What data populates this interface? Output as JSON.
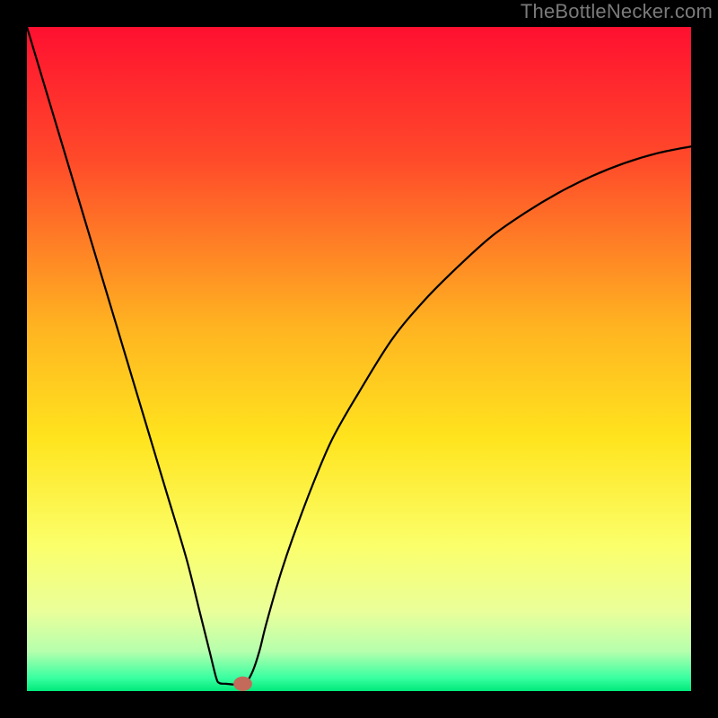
{
  "watermark": "TheBottleNecker.com",
  "chart_data": {
    "type": "line",
    "title": "",
    "xlabel": "",
    "ylabel": "",
    "xlim": [
      0,
      100
    ],
    "ylim": [
      0,
      100
    ],
    "gradient_stops": [
      {
        "offset": 0,
        "color": "#ff1030"
      },
      {
        "offset": 20,
        "color": "#ff4a2a"
      },
      {
        "offset": 45,
        "color": "#ffb321"
      },
      {
        "offset": 62,
        "color": "#ffe41e"
      },
      {
        "offset": 78,
        "color": "#fbff6a"
      },
      {
        "offset": 88,
        "color": "#eaff9a"
      },
      {
        "offset": 94,
        "color": "#b6ffad"
      },
      {
        "offset": 98,
        "color": "#3affa1"
      },
      {
        "offset": 100,
        "color": "#00e97a"
      }
    ],
    "curve_points": [
      {
        "x": 0,
        "y": 100
      },
      {
        "x": 3,
        "y": 90
      },
      {
        "x": 6,
        "y": 80
      },
      {
        "x": 9,
        "y": 70
      },
      {
        "x": 12,
        "y": 60
      },
      {
        "x": 15,
        "y": 50
      },
      {
        "x": 18,
        "y": 40
      },
      {
        "x": 21,
        "y": 30
      },
      {
        "x": 24,
        "y": 20
      },
      {
        "x": 26,
        "y": 12
      },
      {
        "x": 27.5,
        "y": 6
      },
      {
        "x": 28.5,
        "y": 2
      },
      {
        "x": 29,
        "y": 1.2
      },
      {
        "x": 30,
        "y": 1.1
      },
      {
        "x": 31,
        "y": 1
      },
      {
        "x": 32,
        "y": 1
      },
      {
        "x": 33,
        "y": 1.3
      },
      {
        "x": 34,
        "y": 3
      },
      {
        "x": 35,
        "y": 6
      },
      {
        "x": 36,
        "y": 10
      },
      {
        "x": 38,
        "y": 17
      },
      {
        "x": 40,
        "y": 23
      },
      {
        "x": 43,
        "y": 31
      },
      {
        "x": 46,
        "y": 38
      },
      {
        "x": 50,
        "y": 45
      },
      {
        "x": 55,
        "y": 53
      },
      {
        "x": 60,
        "y": 59
      },
      {
        "x": 65,
        "y": 64
      },
      {
        "x": 70,
        "y": 68.5
      },
      {
        "x": 75,
        "y": 72
      },
      {
        "x": 80,
        "y": 75
      },
      {
        "x": 85,
        "y": 77.5
      },
      {
        "x": 90,
        "y": 79.5
      },
      {
        "x": 95,
        "y": 81
      },
      {
        "x": 100,
        "y": 82
      }
    ],
    "marker": {
      "x": 32.5,
      "y": 1.1,
      "rx": 1.4,
      "ry": 1.1,
      "color": "#c36a5a"
    },
    "curve_color": "#000000",
    "curve_width": 2.2
  }
}
